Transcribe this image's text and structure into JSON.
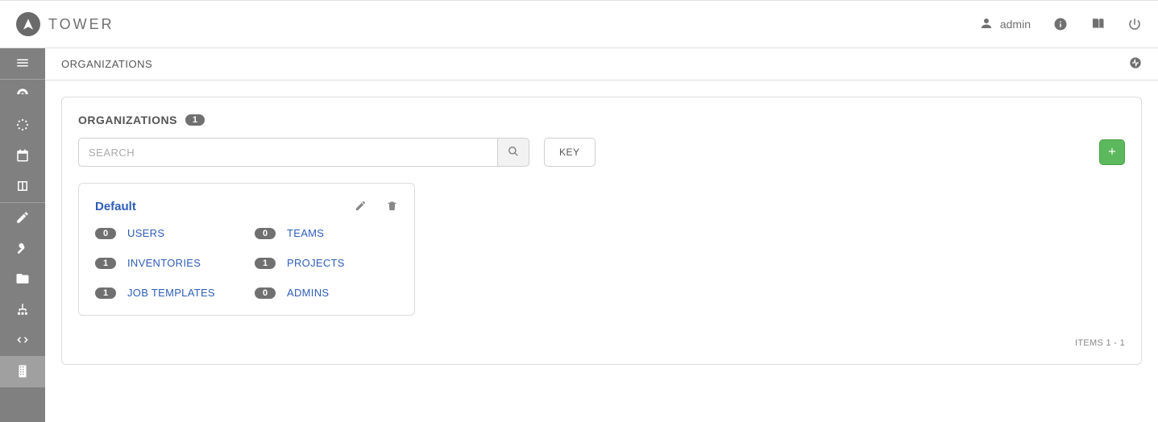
{
  "header": {
    "brand": "TOWER",
    "username": "admin"
  },
  "breadcrumb": {
    "title": "ORGANIZATIONS"
  },
  "panel": {
    "title": "ORGANIZATIONS",
    "count": "1",
    "search_placeholder": "SEARCH",
    "key_label": "KEY",
    "items_text": "ITEMS  1 - 1"
  },
  "org": {
    "name": "Default",
    "stats": {
      "users_count": "0",
      "users_label": "USERS",
      "teams_count": "0",
      "teams_label": "TEAMS",
      "inventories_count": "1",
      "inventories_label": "INVENTORIES",
      "projects_count": "1",
      "projects_label": "PROJECTS",
      "jobtemplates_count": "1",
      "jobtemplates_label": "JOB TEMPLATES",
      "admins_count": "0",
      "admins_label": "ADMINS"
    }
  }
}
